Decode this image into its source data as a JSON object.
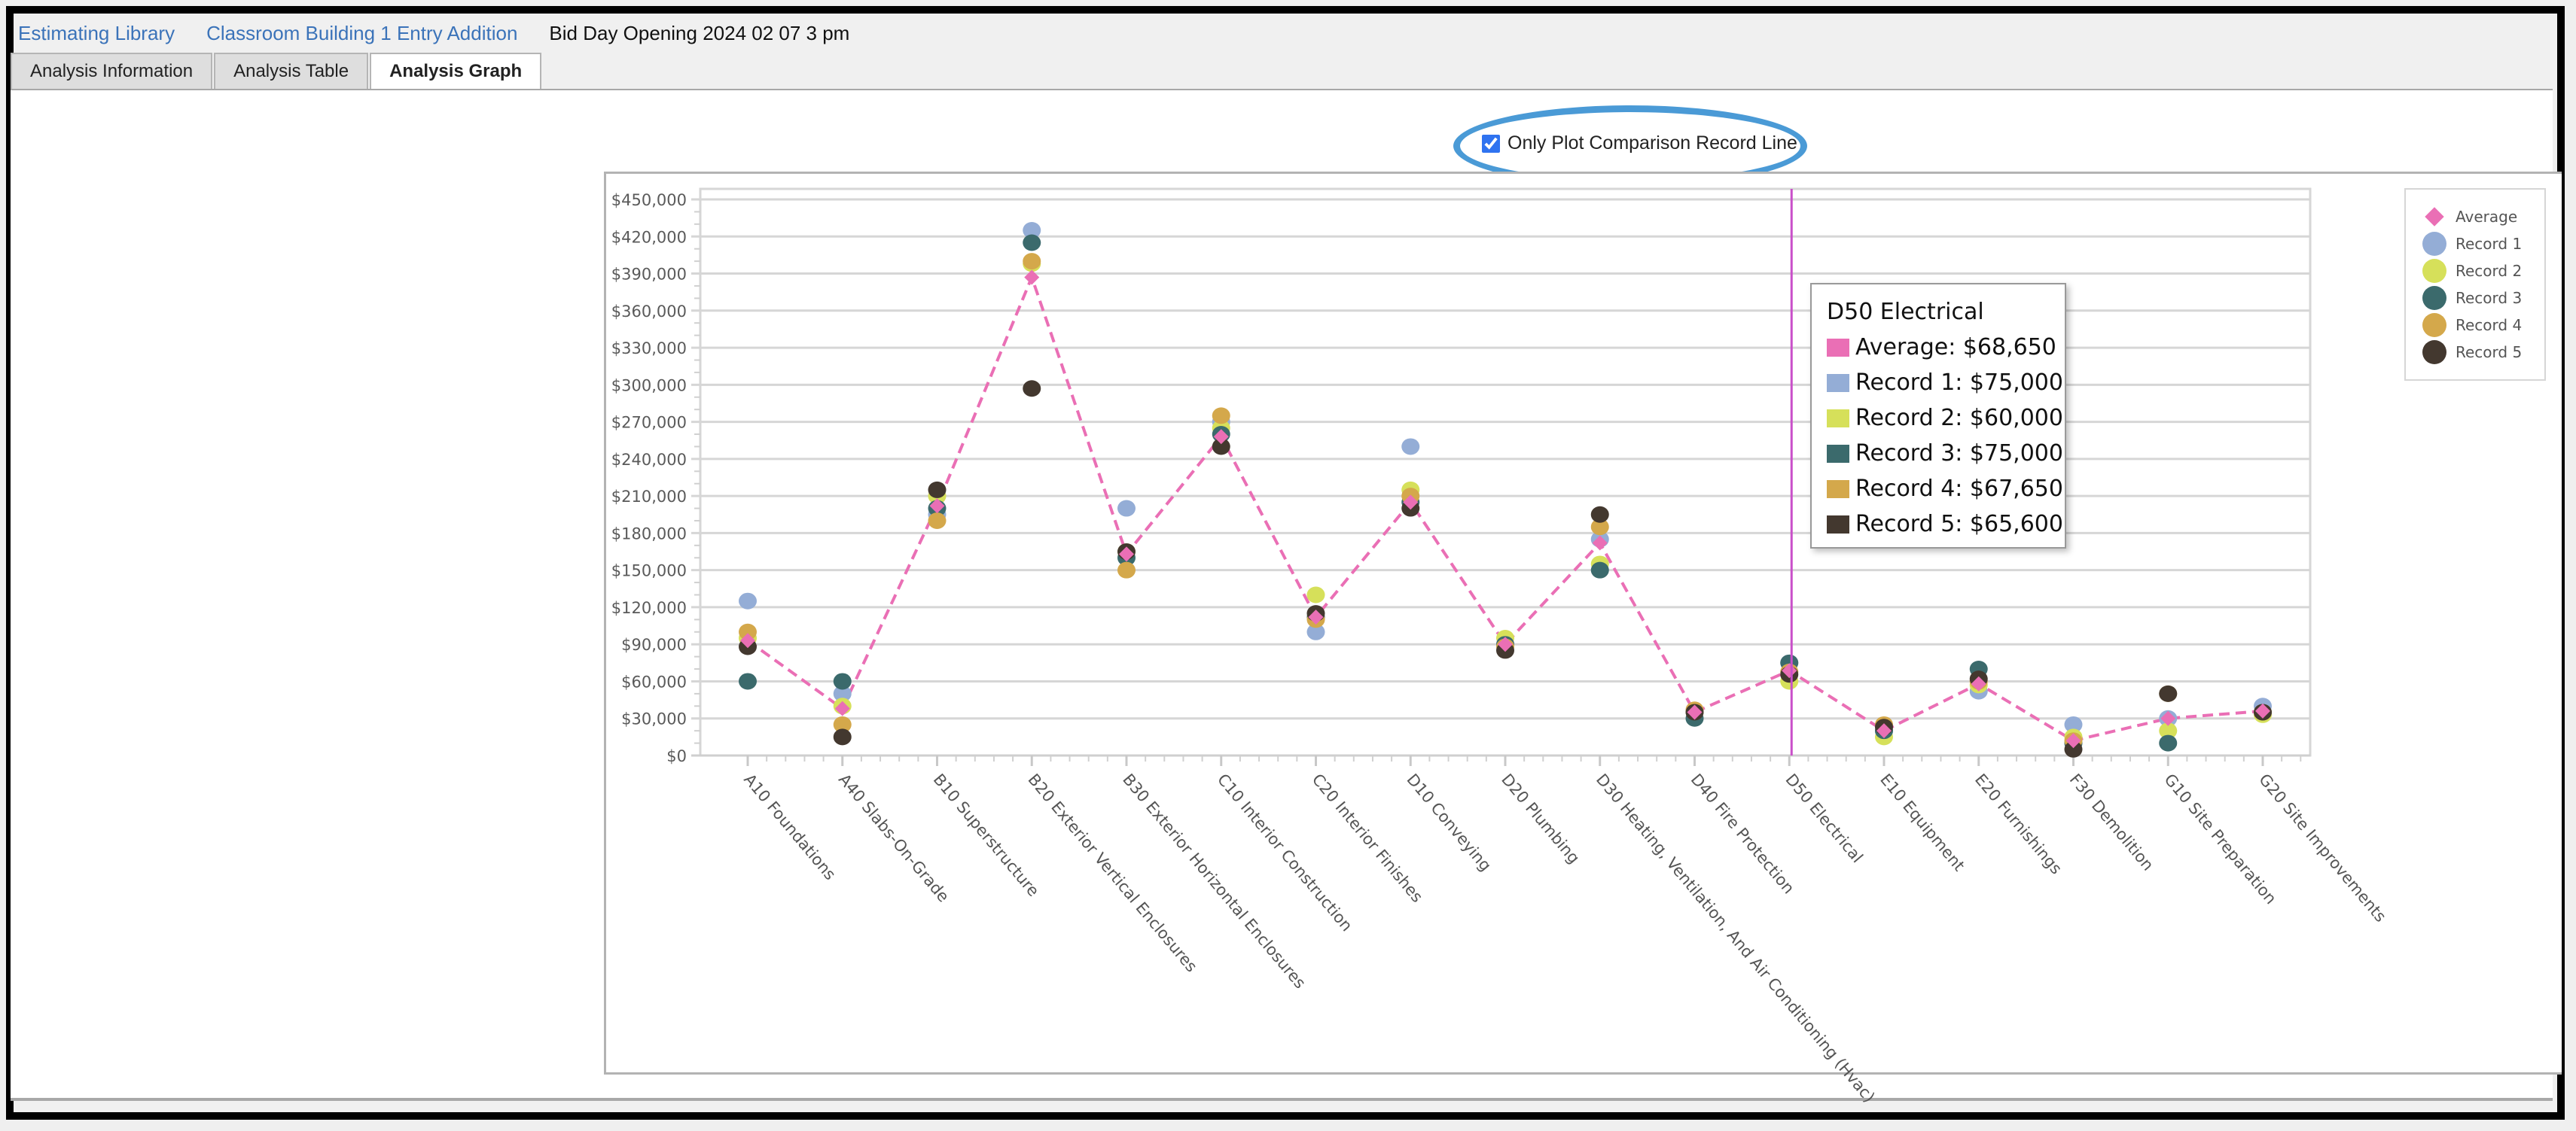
{
  "breadcrumb": {
    "items": [
      {
        "label": "Estimating Library",
        "link": true
      },
      {
        "label": "Classroom Building 1 Entry Addition",
        "link": true
      },
      {
        "label": "Bid Day Opening 2024 02 07 3 pm",
        "link": false
      }
    ]
  },
  "tabs": [
    {
      "label": "Analysis Information",
      "active": false
    },
    {
      "label": "Analysis Table",
      "active": false
    },
    {
      "label": "Analysis Graph",
      "active": true
    }
  ],
  "options": {
    "only_plot_comparison_label": "Only Plot Comparison Record Line",
    "only_plot_comparison_checked": true
  },
  "legend": {
    "items": [
      {
        "label": "Average",
        "shape": "diamond",
        "color": "#ea6fb5"
      },
      {
        "label": "Record 1",
        "shape": "circle",
        "color": "#94add6"
      },
      {
        "label": "Record 2",
        "shape": "circle",
        "color": "#d6e05a"
      },
      {
        "label": "Record 3",
        "shape": "circle",
        "color": "#3b6a6c"
      },
      {
        "label": "Record 4",
        "shape": "circle",
        "color": "#d4a84b"
      },
      {
        "label": "Record 5",
        "shape": "circle",
        "color": "#43382f"
      }
    ]
  },
  "tooltip": {
    "title": "D50 Electrical",
    "rows": [
      {
        "label": "Average: $68,650",
        "color": "#ea6fb5"
      },
      {
        "label": "Record 1: $75,000",
        "color": "#94add6"
      },
      {
        "label": "Record 2: $60,000",
        "color": "#d6e05a"
      },
      {
        "label": "Record 3: $75,000",
        "color": "#3b6a6c"
      },
      {
        "label": "Record 4: $67,650",
        "color": "#d4a84b"
      },
      {
        "label": "Record 5: $65,600",
        "color": "#43382f"
      }
    ]
  },
  "colors": {
    "crosshair": "#c94fc9",
    "gridline": "#d6d6d6",
    "highlight_ellipse": "#4a9ad6"
  },
  "chart_data": {
    "type": "scatter",
    "title": "",
    "xlabel": "",
    "ylabel": "",
    "ylim": [
      0,
      450000
    ],
    "y_tick_step": 30000,
    "y_ticks": [
      "$0",
      "$30,000",
      "$60,000",
      "$90,000",
      "$120,000",
      "$150,000",
      "$180,000",
      "$210,000",
      "$240,000",
      "$270,000",
      "$300,000",
      "$330,000",
      "$360,000",
      "$390,000",
      "$420,000",
      "$450,000"
    ],
    "grid": true,
    "legend_position": "right",
    "hover_category": "D50 Electrical",
    "categories": [
      "A10 Foundations",
      "A40 Slabs-On-Grade",
      "B10 Superstructure",
      "B20 Exterior Vertical Enclosures",
      "B30 Exterior Horizontal Enclosures",
      "C10 Interior Construction",
      "C20 Interior Finishes",
      "D10 Conveying",
      "D20 Plumbing",
      "D30 Heating, Ventilation, And Air Conditioning (Hvac)",
      "D40 Fire Protection",
      "D50 Electrical",
      "E10 Equipment",
      "E20 Furnishings",
      "F30 Demolition",
      "G10 Site Preparation",
      "G20 Site Improvements"
    ],
    "series": [
      {
        "name": "Average",
        "style": "dashed-line-diamond",
        "color": "#ea6fb5",
        "values": [
          93000,
          38000,
          202000,
          387000,
          163000,
          258000,
          112000,
          205000,
          90000,
          172000,
          35000,
          68650,
          20000,
          58000,
          12000,
          30000,
          36000
        ]
      },
      {
        "name": "Record 1",
        "style": "marker",
        "color": "#94add6",
        "values": [
          125000,
          50000,
          195000,
          425000,
          200000,
          270000,
          100000,
          250000,
          90000,
          175000,
          35000,
          75000,
          20000,
          52000,
          25000,
          30000,
          40000
        ]
      },
      {
        "name": "Record 2",
        "style": "marker",
        "color": "#d6e05a",
        "values": [
          95000,
          40000,
          210000,
          398000,
          165000,
          265000,
          130000,
          215000,
          95000,
          155000,
          35000,
          60000,
          15000,
          57000,
          15000,
          20000,
          33000
        ]
      },
      {
        "name": "Record 3",
        "style": "marker",
        "color": "#3b6a6c",
        "values": [
          60000,
          60000,
          200000,
          415000,
          160000,
          260000,
          112000,
          205000,
          90000,
          150000,
          30000,
          75000,
          20000,
          70000,
          10000,
          10000,
          35000
        ]
      },
      {
        "name": "Record 4",
        "style": "marker",
        "color": "#d4a84b",
        "values": [
          100000,
          25000,
          190000,
          400000,
          150000,
          275000,
          110000,
          210000,
          88000,
          185000,
          37000,
          67650,
          25000,
          60000,
          12000,
          50000,
          35000
        ]
      },
      {
        "name": "Record 5",
        "style": "marker",
        "color": "#43382f",
        "values": [
          88000,
          15000,
          215000,
          297000,
          165000,
          250000,
          115000,
          200000,
          85000,
          195000,
          35000,
          65600,
          23000,
          62000,
          5000,
          50000,
          35000
        ]
      }
    ]
  }
}
